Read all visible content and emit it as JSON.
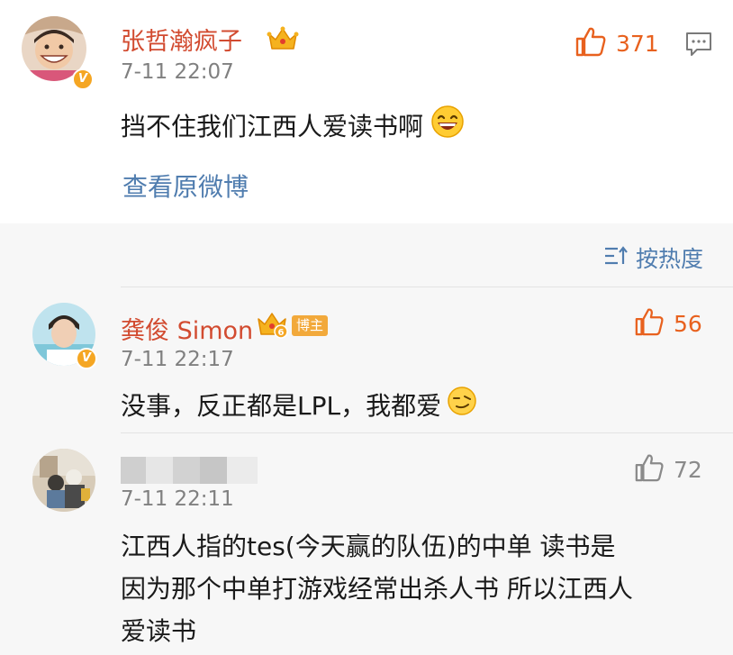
{
  "main_post": {
    "username": "张哲瀚疯子",
    "time": "7-11 22:07",
    "text": "挡不住我们江西人爱读书啊",
    "likes": "371",
    "view_original": "查看原微博",
    "avatar_badge": "V"
  },
  "sort": {
    "label": "按热度"
  },
  "comments": [
    {
      "username": "龚俊 Simon",
      "tag": "博主",
      "time": "7-11 22:17",
      "text": "没事，反正都是LPL，我都爱",
      "likes": "56",
      "avatar_badge": "V"
    },
    {
      "username": "",
      "time": "7-11 22:11",
      "text_lines": [
        "江西人指的tes(今天赢的队伍)的中单 读书是",
        "因为那个中单打游戏经常出杀人书 所以江西人",
        "爱读书"
      ],
      "likes": "72"
    }
  ],
  "colors": {
    "username": "#d24b30",
    "link": "#507daf",
    "like_active": "#e8611e",
    "like_inactive": "#8a8a8a",
    "time": "#808080",
    "comments_bg": "#f7f7f7",
    "vip_gold": "#f5a623"
  },
  "icons": [
    "thumbs-up-icon",
    "comment-icon",
    "vip-crown-icon",
    "vip-crown-6-icon",
    "grin-emoji-icon",
    "smirk-emoji-icon",
    "sort-icon",
    "verified-badge-icon"
  ]
}
